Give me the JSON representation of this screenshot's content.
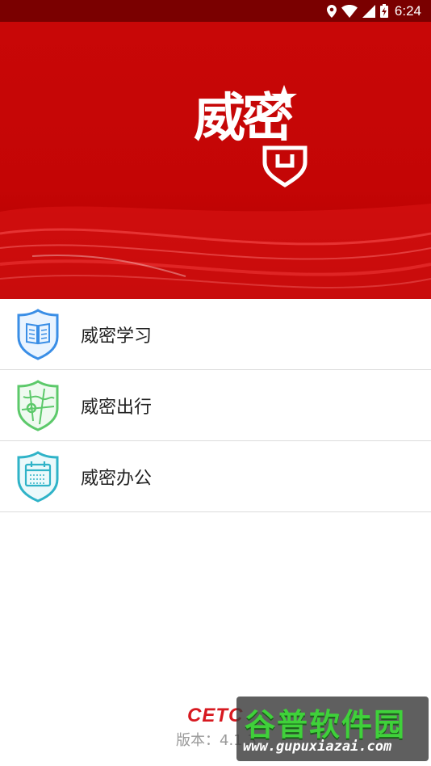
{
  "status_bar": {
    "time": "6:24",
    "icons": [
      "location-icon",
      "wifi-icon",
      "signal-icon",
      "battery-charging-icon"
    ]
  },
  "banner": {
    "logo_text": "威密",
    "background_color": "#c40606"
  },
  "menu": {
    "items": [
      {
        "label": "威密学习",
        "icon": "book-shield-icon",
        "color": "#3a8ee6"
      },
      {
        "label": "威密出行",
        "icon": "map-shield-icon",
        "color": "#5cc96a"
      },
      {
        "label": "威密办公",
        "icon": "calendar-shield-icon",
        "color": "#2fb3c8"
      }
    ]
  },
  "footer": {
    "brand": "CETC",
    "version": "版本：4.1.3"
  },
  "watermark": {
    "title": "谷普软件园",
    "url": "www.gupuxiazai.com"
  }
}
